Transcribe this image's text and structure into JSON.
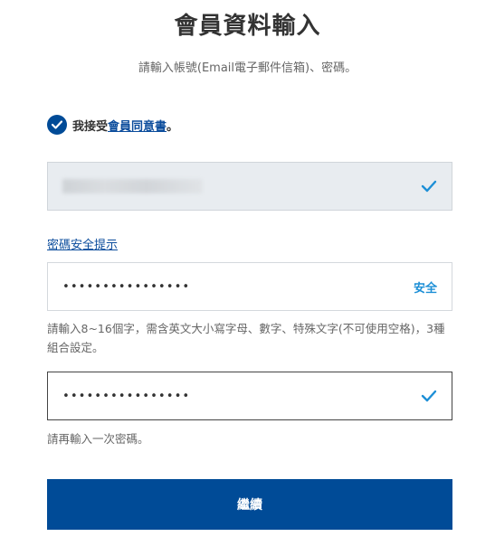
{
  "page": {
    "title": "會員資料輸入",
    "subtitle": "請輸入帳號(Email電子郵件信箱)、密碼。"
  },
  "agreement": {
    "prefix": "我接受",
    "link_label": "會員同意書",
    "suffix": "。",
    "checked": true
  },
  "account_field": {
    "value": "",
    "status_icon": "check-icon"
  },
  "password_tip_link": "密碼安全提示",
  "password_field": {
    "value": "••••••••••••••••",
    "strength_label": "安全"
  },
  "password_help": "請輸入8~16個字，需含英文大小寫字母、數字、特殊文字(不可使用空格)，3種組合設定。",
  "confirm_field": {
    "value": "••••••••••••••••",
    "status_icon": "check-icon"
  },
  "confirm_help": "請再輸入一次密碼。",
  "continue_label": "繼續",
  "colors": {
    "primary": "#004b97",
    "link": "#0b4c9c",
    "accent": "#1d8fd6"
  }
}
